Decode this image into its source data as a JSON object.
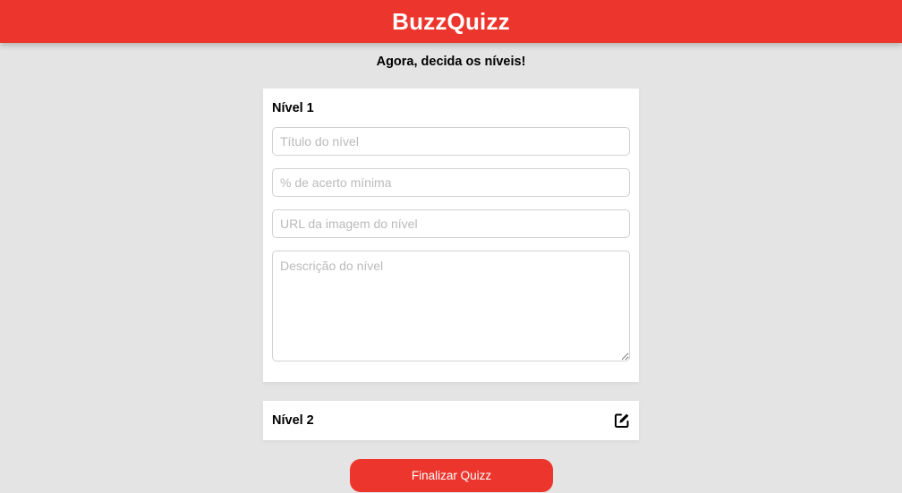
{
  "header": {
    "title": "BuzzQuizz",
    "brand_color": "#ec362d"
  },
  "page": {
    "subtitle": "Agora, decida os níveis!"
  },
  "levels": [
    {
      "title": "Nível 1",
      "expanded": true,
      "fields": {
        "title_placeholder": "Título do nível",
        "min_score_placeholder": "% de acerto mínima",
        "image_url_placeholder": "URL da imagem do nível",
        "description_placeholder": "Descrição do nível"
      }
    },
    {
      "title": "Nível 2",
      "expanded": false,
      "icon": "edit-icon"
    }
  ],
  "actions": {
    "finish_label": "Finalizar Quizz"
  }
}
